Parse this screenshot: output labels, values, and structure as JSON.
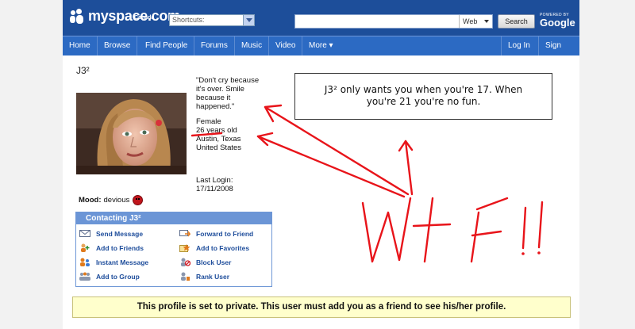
{
  "header": {
    "logo_text": "myspace.com",
    "logo_sub": "Canada",
    "shortcuts_label": "Shortcuts:",
    "search_scope": "Web",
    "search_button": "Search",
    "powered_by": "POWERED BY",
    "powered_brand": "Google"
  },
  "nav": {
    "items": [
      "Home",
      "Browse",
      "Find People",
      "Forums",
      "Music",
      "Video",
      "More ▾"
    ],
    "login": "Log In",
    "signup": "Sign Up"
  },
  "profile": {
    "name": "J3²",
    "quote": [
      "\"Don't cry because",
      "it's over. Smile",
      "because it",
      "happened.\""
    ],
    "gender": "Female",
    "age": "26 years old",
    "city": "Austin, Texas",
    "country": "United States",
    "last_login_label": "Last Login:",
    "last_login_date": "17/11/2008",
    "mood_label": "Mood:",
    "mood_value": "devious"
  },
  "contact": {
    "title": "Contacting J3²",
    "items": [
      "Send Message",
      "Forward to Friend",
      "Add to Friends",
      "Add to Favorites",
      "Instant Message",
      "Block User",
      "Add to Group",
      "Rank User"
    ]
  },
  "annotation": {
    "message": [
      "J3² only wants you when you're 17. When",
      "you're 21 you're no fun."
    ],
    "scrawl_color": "#e8141a"
  },
  "private_notice": "This profile is set to private. This user must add you as a friend to see his/her profile.",
  "colors": {
    "header_bg": "#1d4e9a",
    "nav_bg": "#2c6ac3",
    "link": "#1e4d9b"
  }
}
